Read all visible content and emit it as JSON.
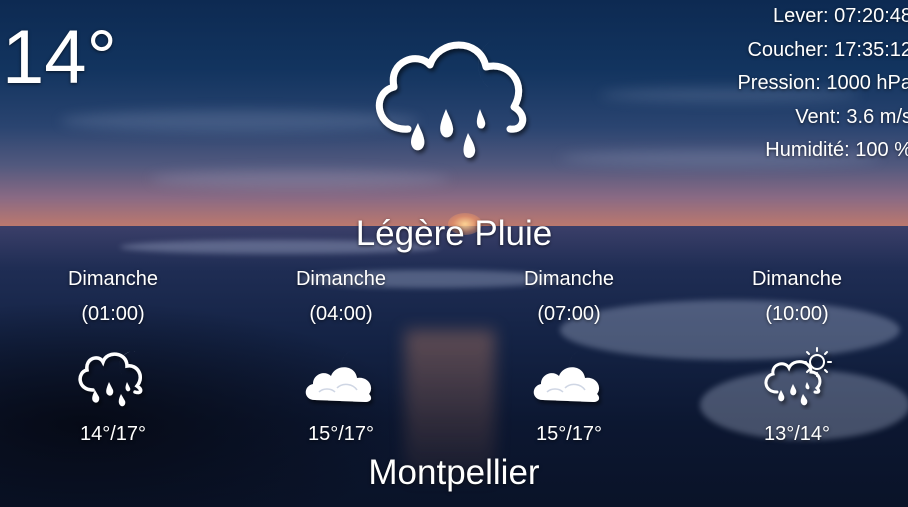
{
  "current": {
    "temperature": "14°",
    "condition": "Légère Pluie",
    "icon": "cloud-rain-moon-icon"
  },
  "details": {
    "sunrise": "Lever: 07:20:48",
    "sunset": "Coucher: 17:35:12",
    "pressure": "Pression: 1000 hPa",
    "wind": "Vent: 3.6 m/s",
    "humidity": "Humidité: 100 %"
  },
  "forecast": [
    {
      "day": "Dimanche",
      "time": "(01:00)",
      "range": "14°/17°",
      "icon": "cloud-rain-moon-icon"
    },
    {
      "day": "Dimanche",
      "time": "(04:00)",
      "range": "15°/17°",
      "icon": "cloud-moon-icon"
    },
    {
      "day": "Dimanche",
      "time": "(07:00)",
      "range": "15°/17°",
      "icon": "cloud-moon-icon"
    },
    {
      "day": "Dimanche",
      "time": "(10:00)",
      "range": "13°/14°",
      "icon": "cloud-rain-sun-icon"
    }
  ],
  "city": "Montpellier"
}
